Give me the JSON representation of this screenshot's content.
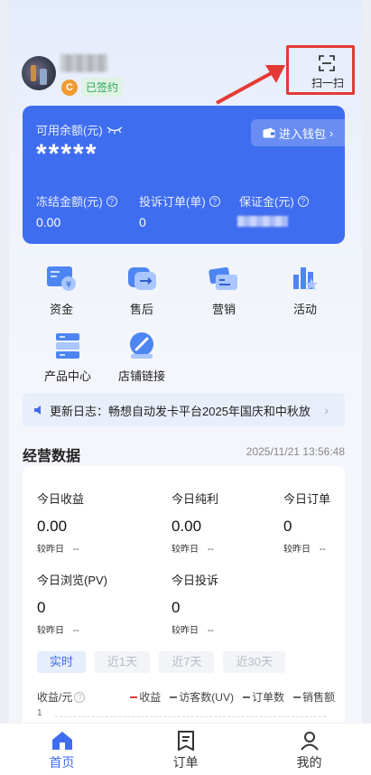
{
  "header": {
    "sign_icon_char": "C",
    "sign_status": "已签约",
    "scan_label": "扫一扫"
  },
  "balance": {
    "available_label": "可用余额(元)",
    "available_value": "*****",
    "wallet_button": "进入钱包",
    "frozen_label": "冻结金额(元)",
    "frozen_value": "0.00",
    "complaint_label": "投诉订单(单)",
    "complaint_value": "0",
    "deposit_label": "保证金(元)"
  },
  "features": [
    {
      "label": "资金",
      "icon": "funds-icon"
    },
    {
      "label": "售后",
      "icon": "after-sales-icon"
    },
    {
      "label": "营销",
      "icon": "marketing-icon"
    },
    {
      "label": "活动",
      "icon": "activity-icon"
    },
    {
      "label": "产品中心",
      "icon": "product-center-icon"
    },
    {
      "label": "店铺链接",
      "icon": "shop-link-icon"
    }
  ],
  "notice": {
    "text": "更新日志：畅想自动发卡平台2025年国庆和中秋放..."
  },
  "stats": {
    "title": "经营数据",
    "timestamp": "2025/11/21 13:56:48",
    "compare_label": "较昨日",
    "items": [
      {
        "label": "今日收益",
        "value": "0.00",
        "compare": "--"
      },
      {
        "label": "今日纯利",
        "value": "0.00",
        "compare": "--"
      },
      {
        "label": "今日订单",
        "value": "0",
        "compare": "--"
      },
      {
        "label": "今日浏览(PV)",
        "value": "0",
        "compare": "--"
      },
      {
        "label": "今日投诉",
        "value": "0",
        "compare": "--"
      }
    ],
    "tabs": [
      "实时",
      "近1天",
      "近7天",
      "近30天"
    ],
    "active_tab": "实时",
    "chart_ylabel": "收益/元",
    "legend": [
      "收益",
      "访客数(UV)",
      "订单数",
      "销售额"
    ],
    "y_tick": "1"
  },
  "nav": {
    "items": [
      "首页",
      "订单",
      "我的"
    ],
    "active": "首页"
  },
  "colors": {
    "primary": "#3f6df0",
    "annotation_red": "#e53935",
    "signed_green": "#2fa35a"
  }
}
